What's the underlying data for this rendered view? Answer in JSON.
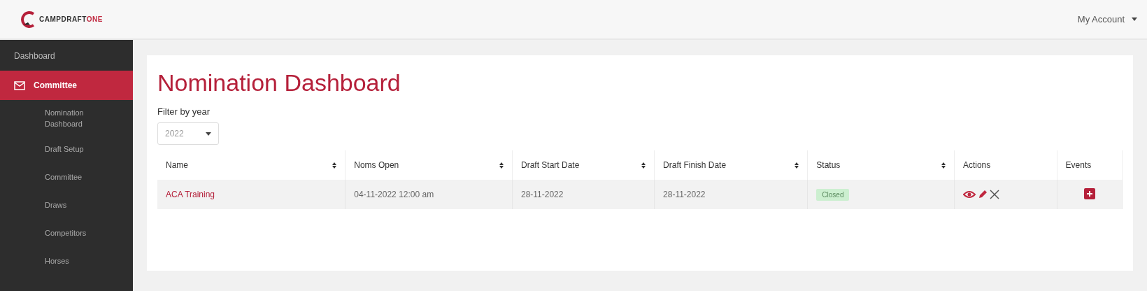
{
  "header": {
    "logo": {
      "text": "CAMPDRAFT",
      "accent": "ONE"
    },
    "account_menu": "My Account"
  },
  "sidebar": {
    "items": [
      {
        "label": "Dashboard",
        "selected": false,
        "icon": false
      },
      {
        "label": "Committee",
        "selected": true,
        "icon": true,
        "children": [
          {
            "label": "Nomination Dashboard",
            "selected": false
          },
          {
            "label": "Draft Setup",
            "selected": false
          },
          {
            "label": "Committee",
            "selected": false
          },
          {
            "label": "Draws",
            "selected": false
          },
          {
            "label": "Competitors",
            "selected": false
          },
          {
            "label": "Horses",
            "selected": false
          }
        ]
      }
    ]
  },
  "page": {
    "title": "Nomination Dashboard",
    "filter": {
      "label": "Filter by year",
      "value": "2022"
    },
    "table": {
      "columns": [
        {
          "label": "Name",
          "sortable": true
        },
        {
          "label": "Noms Open",
          "sortable": true
        },
        {
          "label": "Draft Start Date",
          "sortable": true
        },
        {
          "label": "Draft Finish Date",
          "sortable": true
        },
        {
          "label": "Status",
          "sortable": true
        },
        {
          "label": "Actions",
          "sortable": false
        },
        {
          "label": "Events",
          "sortable": false
        }
      ],
      "rows": [
        {
          "name": "ACA Training",
          "noms_open": "04-11-2022 12:00 am",
          "draft_start": "28-11-2022",
          "draft_finish": "28-11-2022",
          "status": "Closed"
        }
      ]
    }
  }
}
